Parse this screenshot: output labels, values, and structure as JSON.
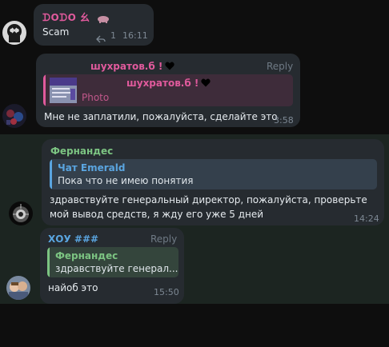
{
  "messages": [
    {
      "sender": "ᗪOᗪO ⺓",
      "text": "Scam",
      "reply_icon": "reply-arrow-icon",
      "reply_count": "1",
      "time": "16:11",
      "sender_color": "#e05a9c"
    },
    {
      "sender": "шухратов.б ! 🖤",
      "reply_label": "Reply",
      "quote": {
        "sender": "шухратов.б ! 🖤",
        "text": "Photo"
      },
      "text": "Мне не заплатили, пожалуйста, сделайте это",
      "time": "3:58",
      "sender_color": "#e05a9c"
    },
    {
      "sender": "Фернандес",
      "quote": {
        "sender": "Чат Emerald",
        "text": "Пока что не имею понятия"
      },
      "text_line1": "здравствуйте генеральный директор, пожалуйста, проверьте",
      "text_line2": "мой вывод средств, я жду его уже 5 дней",
      "time": "14:24",
      "sender_color": "#7cc482"
    },
    {
      "sender": "ХОУ ###",
      "reply_label": "Reply",
      "quote": {
        "sender": "Фернандес",
        "text": "здравствуйте генерал..."
      },
      "text": "найоб это",
      "time": "15:50",
      "sender_color": "#5aa5e0"
    }
  ],
  "colors": {
    "bubble": "#262b30",
    "highlight": "#1c2521",
    "green": "#7cc482",
    "pink": "#e05a9c",
    "blue": "#5aa5e0"
  }
}
